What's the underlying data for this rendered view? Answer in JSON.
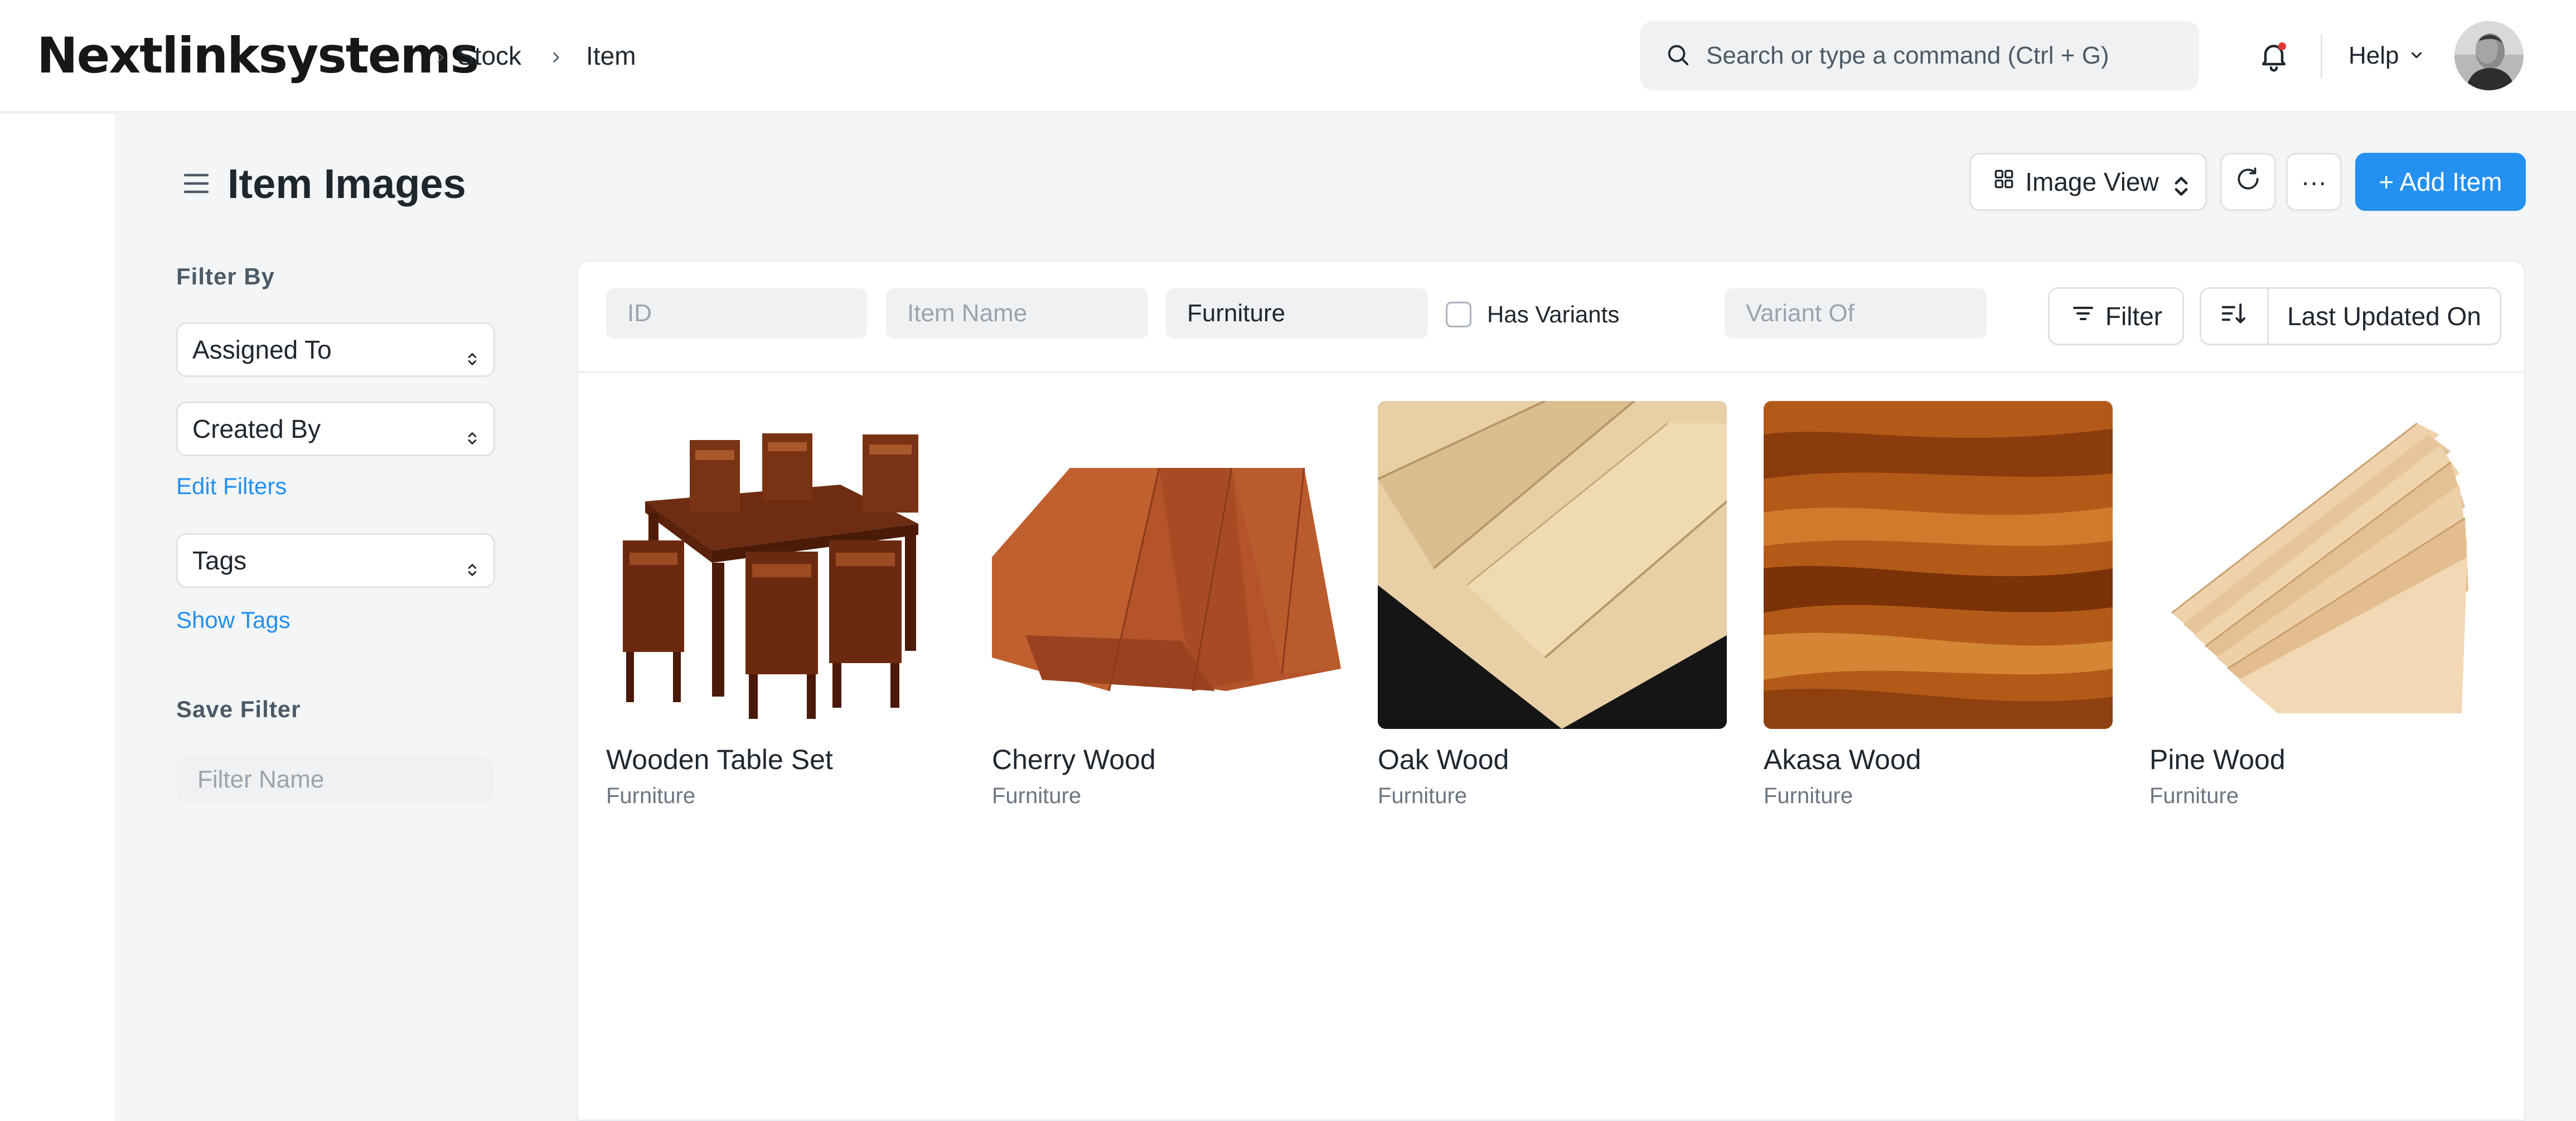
{
  "navbar": {
    "brand": "Nextlinksystems",
    "breadcrumbs": [
      "Stock",
      "Item"
    ],
    "search_placeholder": "Search or type a command (Ctrl + G)",
    "help_label": "Help"
  },
  "page": {
    "title": "Item Images",
    "view_label": "Image View",
    "more_label": "···",
    "add_label": "+ Add Item"
  },
  "sidebar": {
    "filter_by": "Filter By",
    "assigned_to": "Assigned To",
    "created_by": "Created By",
    "edit_filters": "Edit Filters",
    "tags": "Tags",
    "show_tags": "Show Tags",
    "save_filter": "Save Filter",
    "filter_name_placeholder": "Filter Name"
  },
  "filters": {
    "id_placeholder": "ID",
    "item_name_placeholder": "Item Name",
    "item_group_value": "Furniture",
    "has_variants_label": "Has Variants",
    "variant_of_placeholder": "Variant Of",
    "filter_label": "Filter",
    "sort_by_label": "Last Updated On"
  },
  "items": [
    {
      "name": "Wooden Table Set",
      "group": "Furniture"
    },
    {
      "name": "Cherry Wood",
      "group": "Furniture"
    },
    {
      "name": "Oak Wood",
      "group": "Furniture"
    },
    {
      "name": "Akasa Wood",
      "group": "Furniture"
    },
    {
      "name": "Pine Wood",
      "group": "Furniture"
    }
  ],
  "colors": {
    "primary": "#2490ef",
    "background": "#f4f5f6",
    "text": "#1f272e",
    "muted": "#6c7680"
  }
}
